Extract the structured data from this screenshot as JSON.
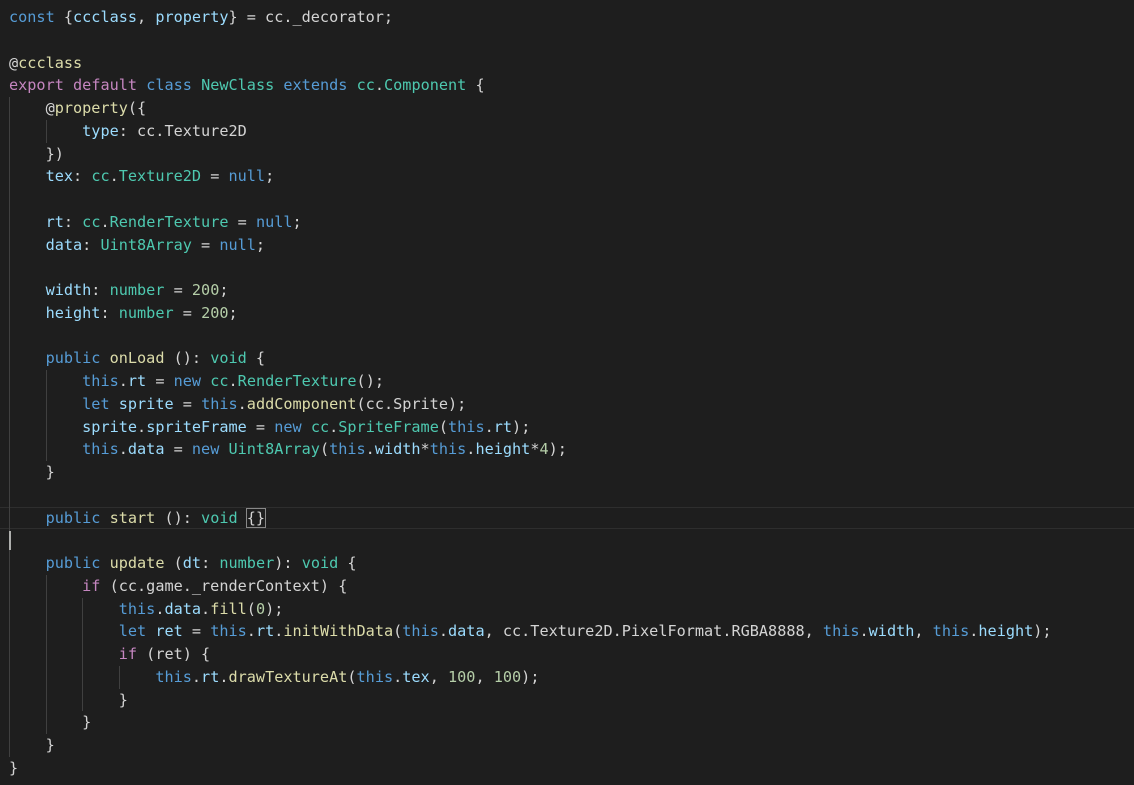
{
  "editor": {
    "language": "TypeScript",
    "theme": "dark",
    "cursor_line": 24,
    "lines": [
      [
        [
          "kw",
          "const"
        ],
        [
          "p",
          " {"
        ],
        [
          "var",
          "ccclass"
        ],
        [
          "p",
          ", "
        ],
        [
          "var",
          "property"
        ],
        [
          "p",
          "} = cc._decorator;"
        ]
      ],
      [],
      [
        [
          "p",
          "@"
        ],
        [
          "fn",
          "ccclass"
        ]
      ],
      [
        [
          "ctl",
          "export"
        ],
        [
          "p",
          " "
        ],
        [
          "ctl",
          "default"
        ],
        [
          "p",
          " "
        ],
        [
          "kw",
          "class"
        ],
        [
          "p",
          " "
        ],
        [
          "type",
          "NewClass"
        ],
        [
          "p",
          " "
        ],
        [
          "kw",
          "extends"
        ],
        [
          "p",
          " "
        ],
        [
          "type",
          "cc"
        ],
        [
          "p",
          "."
        ],
        [
          "type",
          "Component"
        ],
        [
          "p",
          " {"
        ]
      ],
      [
        [
          "p",
          "    @"
        ],
        [
          "fn",
          "property"
        ],
        [
          "p",
          "({"
        ]
      ],
      [
        [
          "p",
          "        "
        ],
        [
          "var",
          "type"
        ],
        [
          "p",
          ": cc.Texture2D"
        ]
      ],
      [
        [
          "p",
          "    })"
        ]
      ],
      [
        [
          "p",
          "    "
        ],
        [
          "var",
          "tex"
        ],
        [
          "p",
          ": "
        ],
        [
          "type",
          "cc"
        ],
        [
          "p",
          "."
        ],
        [
          "type",
          "Texture2D"
        ],
        [
          "p",
          " = "
        ],
        [
          "kw",
          "null"
        ],
        [
          "p",
          ";"
        ]
      ],
      [],
      [
        [
          "p",
          "    "
        ],
        [
          "var",
          "rt"
        ],
        [
          "p",
          ": "
        ],
        [
          "type",
          "cc"
        ],
        [
          "p",
          "."
        ],
        [
          "type",
          "RenderTexture"
        ],
        [
          "p",
          " = "
        ],
        [
          "kw",
          "null"
        ],
        [
          "p",
          ";"
        ]
      ],
      [
        [
          "p",
          "    "
        ],
        [
          "var",
          "data"
        ],
        [
          "p",
          ": "
        ],
        [
          "type",
          "Uint8Array"
        ],
        [
          "p",
          " = "
        ],
        [
          "kw",
          "null"
        ],
        [
          "p",
          ";"
        ]
      ],
      [],
      [
        [
          "p",
          "    "
        ],
        [
          "var",
          "width"
        ],
        [
          "p",
          ": "
        ],
        [
          "type",
          "number"
        ],
        [
          "p",
          " = "
        ],
        [
          "num",
          "200"
        ],
        [
          "p",
          ";"
        ]
      ],
      [
        [
          "p",
          "    "
        ],
        [
          "var",
          "height"
        ],
        [
          "p",
          ": "
        ],
        [
          "type",
          "number"
        ],
        [
          "p",
          " = "
        ],
        [
          "num",
          "200"
        ],
        [
          "p",
          ";"
        ]
      ],
      [],
      [
        [
          "p",
          "    "
        ],
        [
          "kw",
          "public"
        ],
        [
          "p",
          " "
        ],
        [
          "fn",
          "onLoad"
        ],
        [
          "p",
          " (): "
        ],
        [
          "type",
          "void"
        ],
        [
          "p",
          " {"
        ]
      ],
      [
        [
          "p",
          "        "
        ],
        [
          "kw",
          "this"
        ],
        [
          "p",
          "."
        ],
        [
          "var",
          "rt"
        ],
        [
          "p",
          " = "
        ],
        [
          "kw",
          "new"
        ],
        [
          "p",
          " "
        ],
        [
          "type",
          "cc"
        ],
        [
          "p",
          "."
        ],
        [
          "type",
          "RenderTexture"
        ],
        [
          "p",
          "();"
        ]
      ],
      [
        [
          "p",
          "        "
        ],
        [
          "kw",
          "let"
        ],
        [
          "p",
          " "
        ],
        [
          "var",
          "sprite"
        ],
        [
          "p",
          " = "
        ],
        [
          "kw",
          "this"
        ],
        [
          "p",
          "."
        ],
        [
          "fn",
          "addComponent"
        ],
        [
          "p",
          "(cc.Sprite);"
        ]
      ],
      [
        [
          "p",
          "        "
        ],
        [
          "var",
          "sprite"
        ],
        [
          "p",
          "."
        ],
        [
          "var",
          "spriteFrame"
        ],
        [
          "p",
          " = "
        ],
        [
          "kw",
          "new"
        ],
        [
          "p",
          " "
        ],
        [
          "type",
          "cc"
        ],
        [
          "p",
          "."
        ],
        [
          "type",
          "SpriteFrame"
        ],
        [
          "p",
          "("
        ],
        [
          "kw",
          "this"
        ],
        [
          "p",
          "."
        ],
        [
          "var",
          "rt"
        ],
        [
          "p",
          ");"
        ]
      ],
      [
        [
          "p",
          "        "
        ],
        [
          "kw",
          "this"
        ],
        [
          "p",
          "."
        ],
        [
          "var",
          "data"
        ],
        [
          "p",
          " = "
        ],
        [
          "kw",
          "new"
        ],
        [
          "p",
          " "
        ],
        [
          "type",
          "Uint8Array"
        ],
        [
          "p",
          "("
        ],
        [
          "kw",
          "this"
        ],
        [
          "p",
          "."
        ],
        [
          "var",
          "width"
        ],
        [
          "p",
          "*"
        ],
        [
          "kw",
          "this"
        ],
        [
          "p",
          "."
        ],
        [
          "var",
          "height"
        ],
        [
          "p",
          "*"
        ],
        [
          "num",
          "4"
        ],
        [
          "p",
          ");"
        ]
      ],
      [
        [
          "p",
          "    }"
        ]
      ],
      [],
      [
        [
          "p",
          "    "
        ],
        [
          "kw",
          "public"
        ],
        [
          "p",
          " "
        ],
        [
          "fn",
          "start"
        ],
        [
          "p",
          " (): "
        ],
        [
          "type",
          "void"
        ],
        [
          "p",
          " "
        ],
        [
          "bm",
          "{}"
        ]
      ],
      [],
      [
        [
          "p",
          "    "
        ],
        [
          "kw",
          "public"
        ],
        [
          "p",
          " "
        ],
        [
          "fn",
          "update"
        ],
        [
          "p",
          " ("
        ],
        [
          "var",
          "dt"
        ],
        [
          "p",
          ": "
        ],
        [
          "type",
          "number"
        ],
        [
          "p",
          "): "
        ],
        [
          "type",
          "void"
        ],
        [
          "p",
          " {"
        ]
      ],
      [
        [
          "p",
          "        "
        ],
        [
          "ctl",
          "if"
        ],
        [
          "p",
          " (cc.game._renderContext) {"
        ]
      ],
      [
        [
          "p",
          "            "
        ],
        [
          "kw",
          "this"
        ],
        [
          "p",
          "."
        ],
        [
          "var",
          "data"
        ],
        [
          "p",
          "."
        ],
        [
          "fn",
          "fill"
        ],
        [
          "p",
          "("
        ],
        [
          "num",
          "0"
        ],
        [
          "p",
          ");"
        ]
      ],
      [
        [
          "p",
          "            "
        ],
        [
          "kw",
          "let"
        ],
        [
          "p",
          " "
        ],
        [
          "var",
          "ret"
        ],
        [
          "p",
          " = "
        ],
        [
          "kw",
          "this"
        ],
        [
          "p",
          "."
        ],
        [
          "var",
          "rt"
        ],
        [
          "p",
          "."
        ],
        [
          "fn",
          "initWithData"
        ],
        [
          "p",
          "("
        ],
        [
          "kw",
          "this"
        ],
        [
          "p",
          "."
        ],
        [
          "var",
          "data"
        ],
        [
          "p",
          ", cc.Texture2D.PixelFormat.RGBA8888, "
        ],
        [
          "kw",
          "this"
        ],
        [
          "p",
          "."
        ],
        [
          "var",
          "width"
        ],
        [
          "p",
          ", "
        ],
        [
          "kw",
          "this"
        ],
        [
          "p",
          "."
        ],
        [
          "var",
          "height"
        ],
        [
          "p",
          ");"
        ]
      ],
      [
        [
          "p",
          "            "
        ],
        [
          "ctl",
          "if"
        ],
        [
          "p",
          " (ret) {"
        ]
      ],
      [
        [
          "p",
          "                "
        ],
        [
          "kw",
          "this"
        ],
        [
          "p",
          "."
        ],
        [
          "var",
          "rt"
        ],
        [
          "p",
          "."
        ],
        [
          "fn",
          "drawTextureAt"
        ],
        [
          "p",
          "("
        ],
        [
          "kw",
          "this"
        ],
        [
          "p",
          "."
        ],
        [
          "var",
          "tex"
        ],
        [
          "p",
          ", "
        ],
        [
          "num",
          "100"
        ],
        [
          "p",
          ", "
        ],
        [
          "num",
          "100"
        ],
        [
          "p",
          ");"
        ]
      ],
      [
        [
          "p",
          "            }"
        ]
      ],
      [
        [
          "p",
          "        }"
        ]
      ],
      [
        [
          "p",
          "    }"
        ]
      ],
      [
        [
          "p",
          "}"
        ]
      ]
    ]
  }
}
